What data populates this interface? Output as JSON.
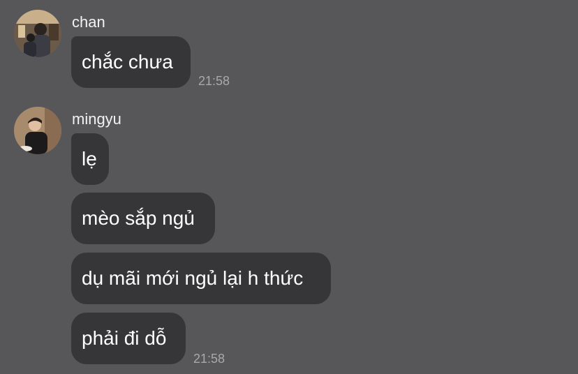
{
  "messages": [
    {
      "sender": "chan",
      "avatar_icon": "user-photo-icon",
      "bubbles": [
        "chắc chưa"
      ],
      "time": "21:58"
    },
    {
      "sender": "mingyu",
      "avatar_icon": "user-photo-icon",
      "bubbles": [
        "lẹ",
        "mèo sắp ngủ",
        "dụ mãi mới ngủ lại h thức",
        "phải đi dỗ"
      ],
      "time": "21:58"
    }
  ],
  "colors": {
    "background": "#575658",
    "bubble": "#363538",
    "text": "#ffffff",
    "timestamp": "#a9a8aa"
  }
}
